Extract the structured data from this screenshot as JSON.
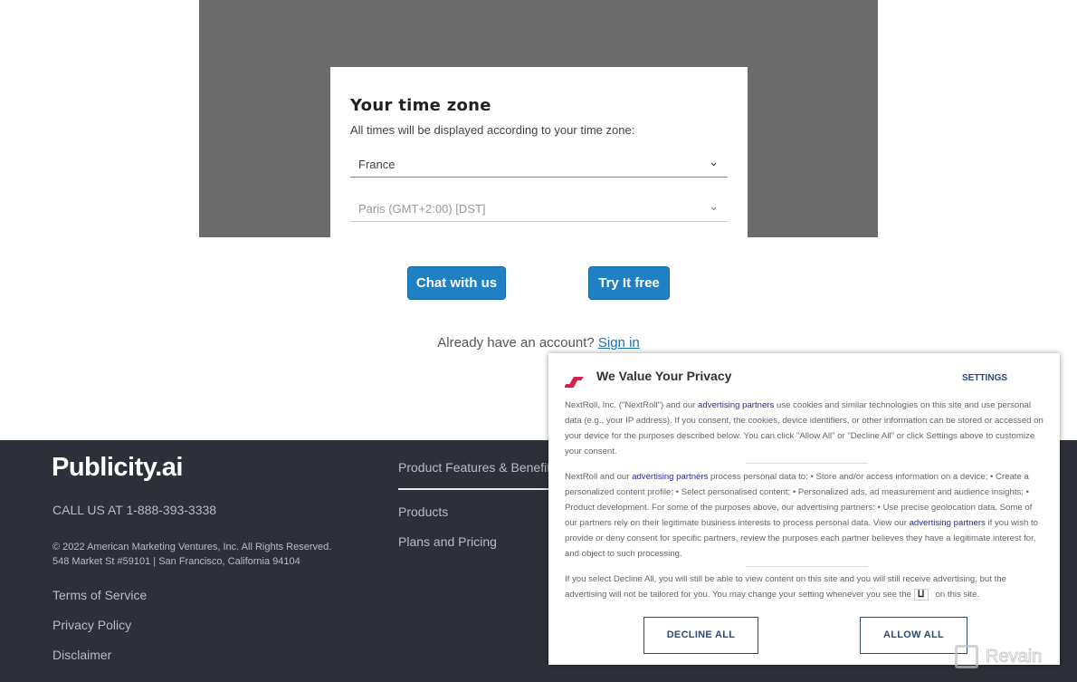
{
  "timezone_modal": {
    "title": "Your time zone",
    "subtitle": "All times will be displayed according to your time zone:",
    "country_select": {
      "value": "France"
    },
    "city_select": {
      "value": "Paris (GMT+2:00) [DST]"
    }
  },
  "actions": {
    "chat_label": "Chat with us",
    "try_label": "Try It free",
    "accent": "#1f80c3"
  },
  "signin": {
    "prompt": "Already have an account?",
    "link": "Sign in"
  },
  "footer": {
    "logo": "Publicity.ai",
    "phone": "CALL US AT 1-888-393-3338",
    "copyright": "© 2022 American Marketing Ventures, Inc. All Rights Reserved.",
    "address": "548 Market St #59101 | San Francisco, California 94104",
    "links": [
      "Terms of Service",
      "Privacy Policy",
      "Disclaimer"
    ],
    "section_title": "Product Features & Benefits",
    "nav": [
      "Products",
      "Plans and Pricing"
    ],
    "background": "#2e3039"
  },
  "privacy": {
    "title": "We Value Your Privacy",
    "settings": "SETTINGS",
    "p1_a": "NextRoll, Inc. (\"NextRoll\") and our ",
    "link": "advertising partners",
    "p1_b": " use cookies and similar technologies on this site and use personal data (e.g., your IP address). If you consent, the cookies, device identifiers, or other information can be stored or accessed on your device for the purposes described below. You can click \"Allow All\" or \"Decline All\" or click Settings above to customize your consent.",
    "p2_a": "NextRoll and our ",
    "p2_b": " process personal data to: • Store and/or access information on a device; • Create a personalized content profile; • Select personalised content; • Personalized ads, ad measurement and audience insights; • Product development. For some of the purposes above, our advertising partners: • Use precise geolocation data. Some of our partners rely on their legitimate business interests to process personal data. View our ",
    "p2_c": " if you wish to provide or deny consent for specific partners, review the purposes each partner believes they have a legitimate interest for, and object to such processing.",
    "p3_a": "If you select Decline All, you will still be able to view content on this site and you will still receive advertising, but the advertising will not be tailored for you. You may change your setting whenever you see the",
    "p3_b": "on this site.",
    "decline": "DECLINE ALL",
    "allow": "ALLOW ALL",
    "brand_color": "#d6204a"
  },
  "watermark": "Revain"
}
